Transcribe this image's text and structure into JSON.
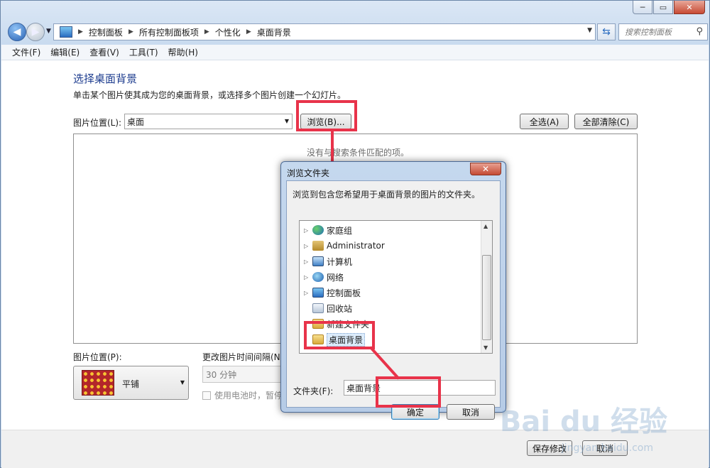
{
  "window": {
    "minimize": "─",
    "restore": "▭",
    "close": "✕"
  },
  "nav": {
    "breadcrumbs": [
      "控制面板",
      "所有控制面板项",
      "个性化",
      "桌面背景"
    ],
    "search_placeholder": "搜索控制面板"
  },
  "menu": [
    "文件(F)",
    "编辑(E)",
    "查看(V)",
    "工具(T)",
    "帮助(H)"
  ],
  "main": {
    "title": "选择桌面背景",
    "description": "单击某个图片使其成为您的桌面背景，或选择多个图片创建一个幻灯片。",
    "location_label": "图片位置(L):",
    "location_value": "桌面",
    "browse_button": "浏览(B)...",
    "select_all_button": "全选(A)",
    "clear_all_button": "全部清除(C)",
    "empty_message": "没有与搜索条件匹配的项。",
    "position_label": "图片位置(P):",
    "position_value": "平铺",
    "interval_label": "更改图片时间间隔(N):",
    "interval_value": "30 分钟",
    "battery_label": "使用电池时，暂停幻"
  },
  "footer": {
    "save_button": "保存修改",
    "cancel_button": "取消"
  },
  "dialog": {
    "title": "浏览文件夹",
    "close": "✕",
    "description": "浏览到包含您希望用于桌面背景的图片的文件夹。",
    "tree": [
      {
        "label": "家庭组",
        "icon": "homegroup-icon"
      },
      {
        "label": "Administrator",
        "icon": "user-folder-icon"
      },
      {
        "label": "计算机",
        "icon": "computer-icon"
      },
      {
        "label": "网络",
        "icon": "network-icon"
      },
      {
        "label": "控制面板",
        "icon": "control-panel-icon"
      },
      {
        "label": "回收站",
        "icon": "recycle-bin-icon"
      },
      {
        "label": "新建文件夹",
        "icon": "folder-icon"
      },
      {
        "label": "桌面背景",
        "icon": "folder-icon"
      }
    ],
    "folder_label": "文件夹(F):",
    "folder_value": "桌面背景",
    "ok_button": "确定",
    "cancel_button": "取消"
  },
  "watermark": {
    "brand": "Bai du 经验",
    "url": "jingyan.baidu.com"
  },
  "colors": {
    "annotation": "#e8334a",
    "title": "#1e3d8f"
  }
}
